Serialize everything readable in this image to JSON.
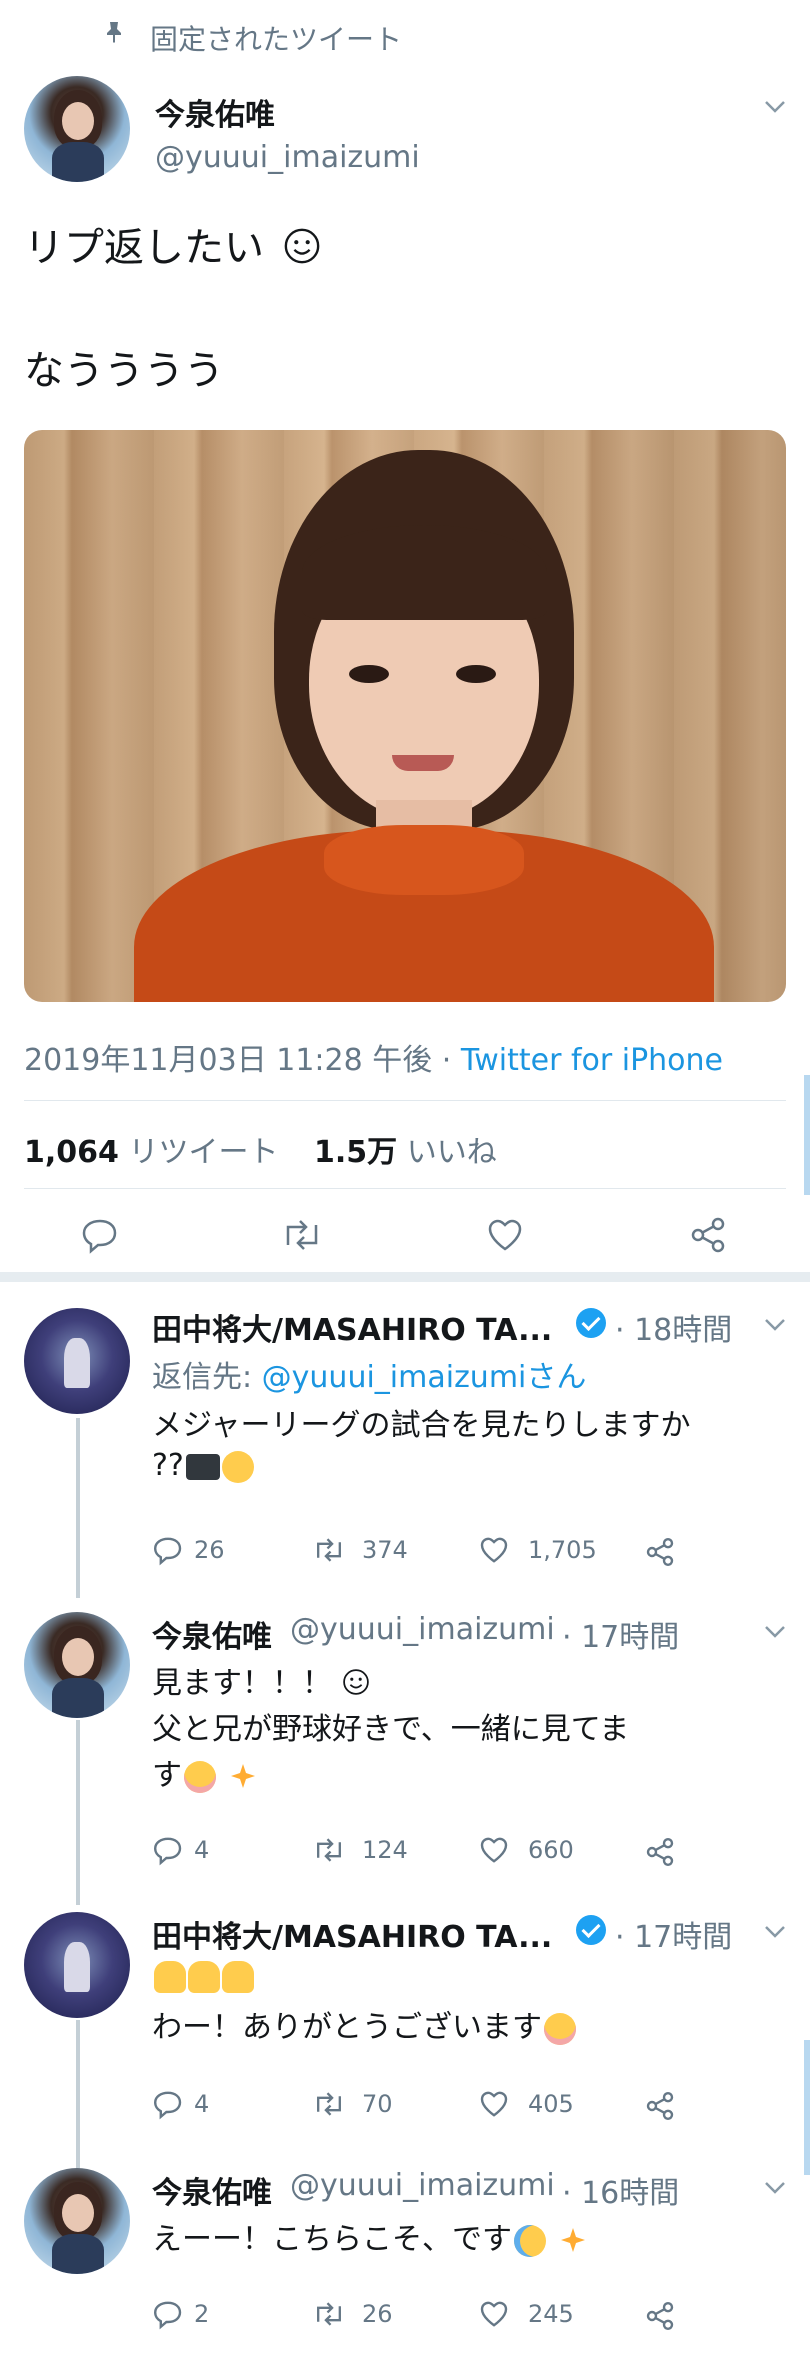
{
  "pinned": {
    "label": "固定されたツイート",
    "icon": "pin-icon"
  },
  "main_tweet": {
    "name": "今泉佑唯",
    "handle": "@yuuui_imaizumi",
    "text_line1": "リプ返したい",
    "text_line1_emoji": "smile-emoji",
    "text_line2": "なうううう",
    "timestamp": "2019年11月03日 11:28 午後",
    "separator": "·",
    "source": "Twitter for iPhone",
    "retweets_count": "1,064",
    "retweets_label": "リツイート",
    "likes_count": "1.5万",
    "likes_label": "いいね"
  },
  "replies": [
    {
      "name": "田中将大/MASAHIRO TA...",
      "verified": true,
      "time": "· 18時間",
      "reply_to_prefix": "返信先: ",
      "reply_to_mention": "@yuuui_imaizumiさん",
      "text_line1": "メジャーリーグの試合を見たりしますか",
      "text_line2": "??",
      "replies": "26",
      "retweets": "374",
      "likes": "1,705"
    },
    {
      "name": "今泉佑唯",
      "handle": "@yuuui_imaizumi",
      "time": "· 17時間",
      "text_line1": "見ます！！！",
      "text_line2": "父と兄が野球好きで、一緒に見てま",
      "text_line3": "す",
      "replies": "4",
      "retweets": "124",
      "likes": "660"
    },
    {
      "name": "田中将大/MASAHIRO TA...",
      "verified": true,
      "time": "· 17時間",
      "text_line1": "わー！ありがとうございます",
      "replies": "4",
      "retweets": "70",
      "likes": "405"
    },
    {
      "name": "今泉佑唯",
      "handle": "@yuuui_imaizumi",
      "time": "· 16時間",
      "text_line1": "えーー！こちらこそ、です",
      "replies": "2",
      "retweets": "26",
      "likes": "245"
    }
  ],
  "colors": {
    "link": "#1b95e0",
    "secondary": "#657786",
    "verified": "#1da1f2",
    "text": "#14171a"
  }
}
